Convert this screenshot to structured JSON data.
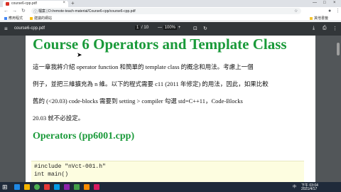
{
  "browser": {
    "tab_title": "course6-cpp.pdf",
    "tab_close": "×",
    "new_tab": "+",
    "win_min": "—",
    "win_max": "□",
    "win_close": "×",
    "back": "←",
    "forward": "→",
    "reload": "↻",
    "url": "檔案 | D:/remote-teach-material/Course6-cpp/course6-cpp.pdf",
    "star": "☆",
    "menu": "⋮"
  },
  "bookmarks": [
    {
      "label": "應用程式"
    },
    {
      "label": "建議的網站"
    }
  ],
  "bookmarks_other": "其他書籤",
  "pdf_toolbar": {
    "menu_icon": "≡",
    "title": "course6-cpp.pdf",
    "page_current": "1",
    "page_sep": "/",
    "page_total": "10",
    "zoom_minus": "—",
    "zoom_value": "100%",
    "zoom_plus": "+",
    "rotate_icon": "↻",
    "download_icon": "⤓",
    "print_icon": "⎙",
    "more_icon": "⋮"
  },
  "document": {
    "title": "Course 6 Operators and Template Class",
    "para_line1": "這一章我將介紹 operator function 和簡單的 template class 的概念和用法。考慮上一個",
    "para_line2": "例子，並把三維擴充為 n 維。以下的程式需要 c11 (2011 年修定) 的用法，因此，如果比較",
    "para_line3": "舊的 (<20.03) code-blocks 需要到 setting > compiler 勾選 std=C++11，Code-Blocks",
    "para_line4": "20.03 就不必設定。",
    "section_title": "Operators (pp6001.cpp)",
    "code_line1": "#include \"nVct-001.h\"",
    "code_line2": "int main()"
  },
  "taskbar": {
    "start": "⊞",
    "tray_lang": "中",
    "tray_time": "下午 03:04",
    "tray_date": "2021/4/17"
  },
  "colors": {
    "title_green": "#1a9a3a",
    "pdf_toolbar": "#323639",
    "viewer_bg": "#525659",
    "code_bg": "#fdfde0"
  }
}
